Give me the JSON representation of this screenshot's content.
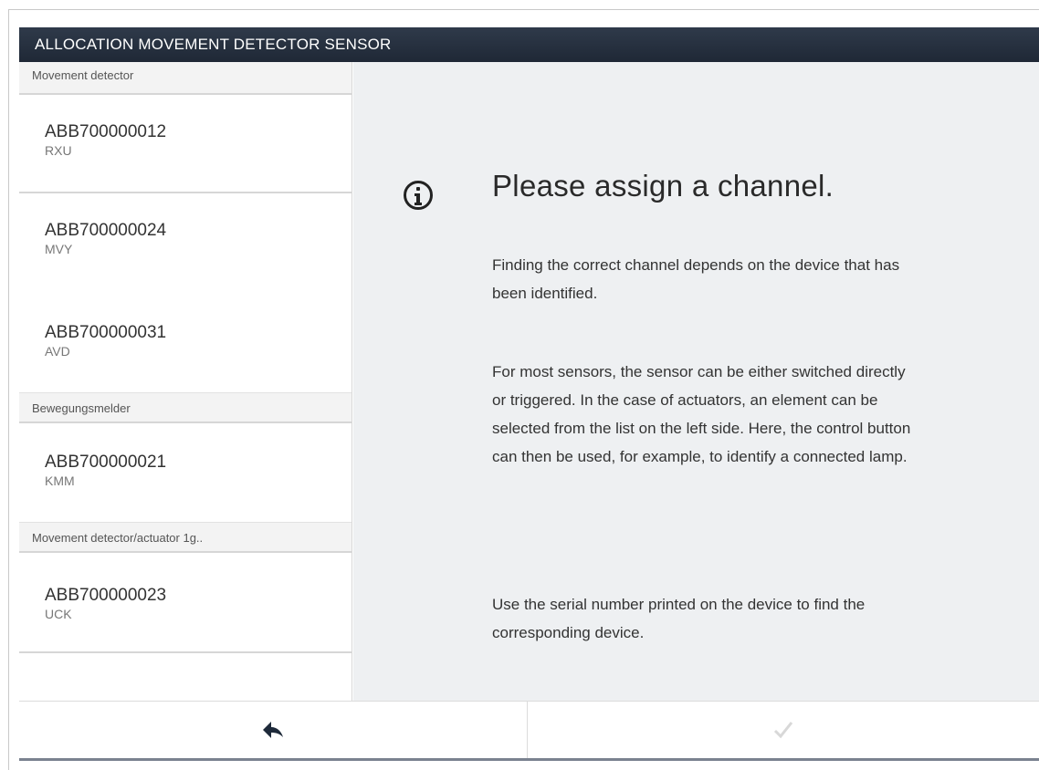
{
  "window": {
    "title": "ALLOCATION MOVEMENT DETECTOR SENSOR"
  },
  "sidebar": {
    "groups": [
      {
        "header": "Movement detector",
        "items": [
          {
            "serial": "ABB700000012",
            "type": "RXU"
          },
          {
            "serial": "ABB700000024",
            "type": "MVY"
          },
          {
            "serial": "ABB700000031",
            "type": "AVD"
          }
        ]
      },
      {
        "header": "Bewegungsmelder",
        "items": [
          {
            "serial": "ABB700000021",
            "type": "KMM"
          }
        ]
      },
      {
        "header": "Movement detector/actuator 1g..",
        "items": [
          {
            "serial": "ABB700000023",
            "type": "UCK"
          }
        ]
      }
    ]
  },
  "main": {
    "heading": "Please assign a channel.",
    "paragraph1": "Finding the correct channel depends on the device that has been identified.",
    "paragraph2": "For most sensors, the sensor can be either switched directly or triggered. In the case of actuators, an element can be selected from the list on the left side. Here, the control button can then be used, for example, to identify a connected lamp.",
    "paragraph3": "Use the serial number printed on the device to find the corresponding device."
  },
  "footer": {
    "back_icon": "back-arrow-icon",
    "confirm_icon": "checkmark-icon"
  },
  "colors": {
    "titlebar": "#1f2836",
    "content_bg": "#eef0f2",
    "checkmark_disabled": "#d8d8d8"
  }
}
